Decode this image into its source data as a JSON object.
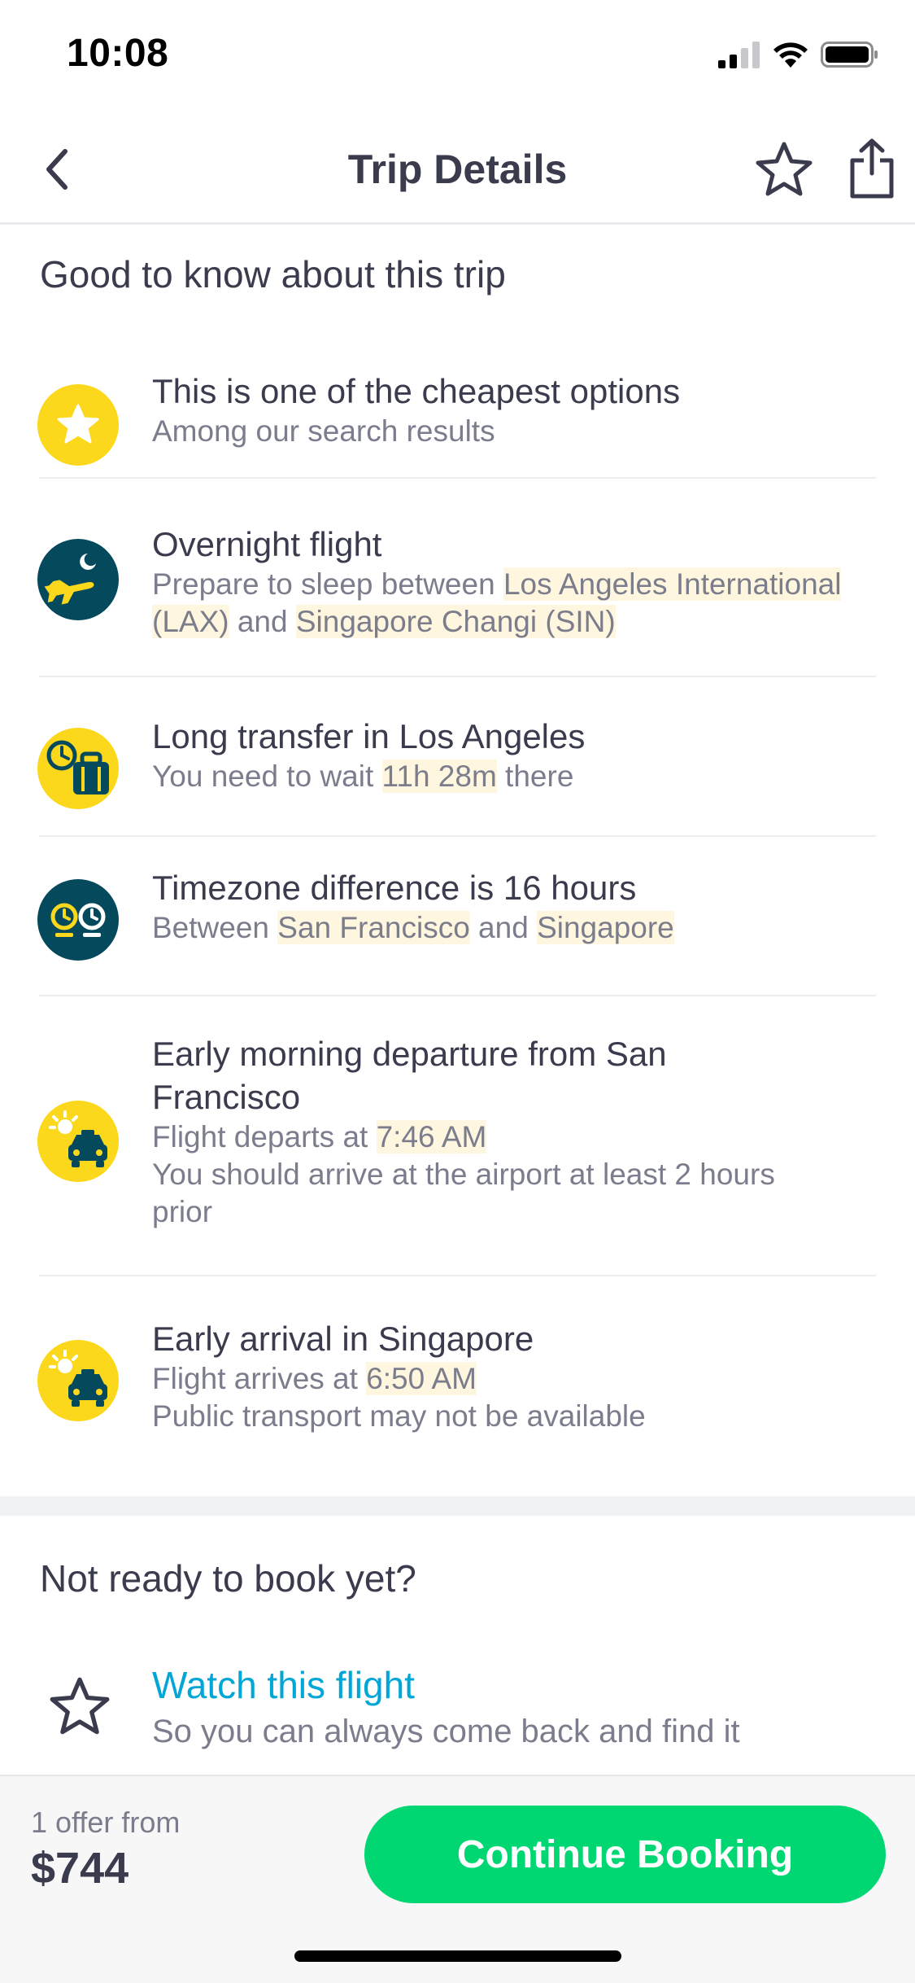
{
  "status": {
    "time": "10:08"
  },
  "header": {
    "title": "Trip Details"
  },
  "good_to_know": {
    "title": "Good to know about this trip",
    "items": [
      {
        "icon": "star-badge-icon",
        "title": "This is one of the cheapest options",
        "sub": "Among our search results"
      },
      {
        "icon": "overnight-plane-icon",
        "title": "Overnight flight",
        "sub_pre": "Prepare to sleep between ",
        "sub_hl1": "Los Angeles International (LAX)",
        "sub_mid": " and ",
        "sub_hl2": "Singapore Changi (SIN)"
      },
      {
        "icon": "transfer-luggage-icon",
        "title": "Long transfer in Los Angeles",
        "sub_pre": "You need to wait ",
        "sub_hl1": "11h 28m",
        "sub_post": " there"
      },
      {
        "icon": "timezone-clocks-icon",
        "title": "Timezone difference is 16 hours",
        "sub_pre": "Between ",
        "sub_hl1": "San Francisco",
        "sub_mid": " and ",
        "sub_hl2": "Singapore"
      },
      {
        "icon": "early-taxi-icon",
        "title": "Early morning departure from San Francisco",
        "sub_pre": "Flight departs at ",
        "sub_hl1": "7:46 AM",
        "sub_line2": "You should arrive at the airport at least 2 hours prior"
      },
      {
        "icon": "early-taxi-icon",
        "title": "Early arrival in Singapore",
        "sub_pre": "Flight arrives at ",
        "sub_hl1": "6:50 AM",
        "sub_line2": "Public transport may not be available"
      }
    ]
  },
  "not_ready": {
    "title": "Not ready to book yet?",
    "watch_label": "Watch this flight",
    "watch_sub": "So you can always come back and find it"
  },
  "footer": {
    "offer_label": "1 offer from",
    "price": "$744",
    "cta_label": "Continue Booking"
  },
  "colors": {
    "accent_green": "#00d773",
    "link_blue": "#00a6d6",
    "highlight": "#fff6df",
    "icon_yellow": "#fcd81d",
    "icon_teal": "#054a5c"
  }
}
